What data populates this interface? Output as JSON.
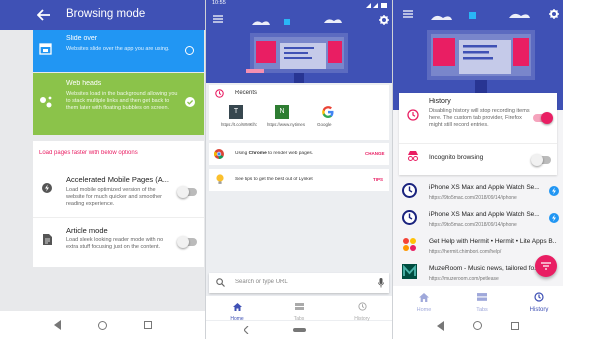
{
  "panel1": {
    "title": "Browsing mode",
    "slide_over": {
      "title": "Slide over",
      "desc": "Websites slide over the app you are using."
    },
    "web_heads": {
      "title": "Web heads",
      "desc": "Websites load in the background allowing you to stack multiple links and then get back to them later with floating bubbles on screen."
    },
    "section_label": "Load pages faster with below options",
    "amp": {
      "title": "Accelerated Mobile Pages (A...",
      "desc": "Load mobile optimized version of the website for much quicker and smoother reading experience."
    },
    "article": {
      "title": "Article mode",
      "desc": "Load sleek looking reader mode with no extra stuff focusing just on the content."
    }
  },
  "panel2": {
    "time": "10:55",
    "recents_label": "Recents",
    "recents": [
      {
        "letter": "T",
        "label": "https://t.co/WMKlh1Ls",
        "color": "#37474f"
      },
      {
        "letter": "N",
        "label": "https://www.nytimes.com/20...",
        "color": "#2e7d32"
      },
      {
        "letter": "G",
        "label": "Google",
        "color": "#ffffff"
      }
    ],
    "chrome": {
      "prefix": "Using ",
      "bold": "Chrome",
      "suffix": " to render web pages.",
      "action": "CHANGE"
    },
    "tips": {
      "text": "See tips to get the best out of Lynket",
      "action": "TIPS"
    },
    "search_placeholder": "Search or type URL",
    "nav": {
      "home": "Home",
      "tabs": "Tabs",
      "history": "History"
    }
  },
  "panel3": {
    "history": {
      "title": "History",
      "desc": "Disabling history will stop recording items here. The custom tab provider, Firefox might still record entries."
    },
    "incognito": "Incognito browsing",
    "items": [
      {
        "title": "iPhone XS Max and Apple Watch Se...",
        "url": "https://9to5mac.com/2018/09/14/iphone"
      },
      {
        "title": "iPhone XS Max and Apple Watch Se...",
        "url": "https://9to5mac.com/2018/09/14/iphone"
      },
      {
        "title": "Get Help with Hermit • Hermit • Lite Apps B...",
        "url": "https://hermit.chimbori.com/help/"
      },
      {
        "title": "MuzeRoom - Music news, tailored fo...",
        "url": "https://muzeroom.com/petlease"
      }
    ],
    "nav": {
      "home": "Home",
      "tabs": "Tabs",
      "history": "History"
    }
  },
  "colors": {
    "primary": "#3f51b5",
    "slide_over": "#2196f3",
    "web_heads": "#8bc34a",
    "accent": "#e91e63"
  }
}
